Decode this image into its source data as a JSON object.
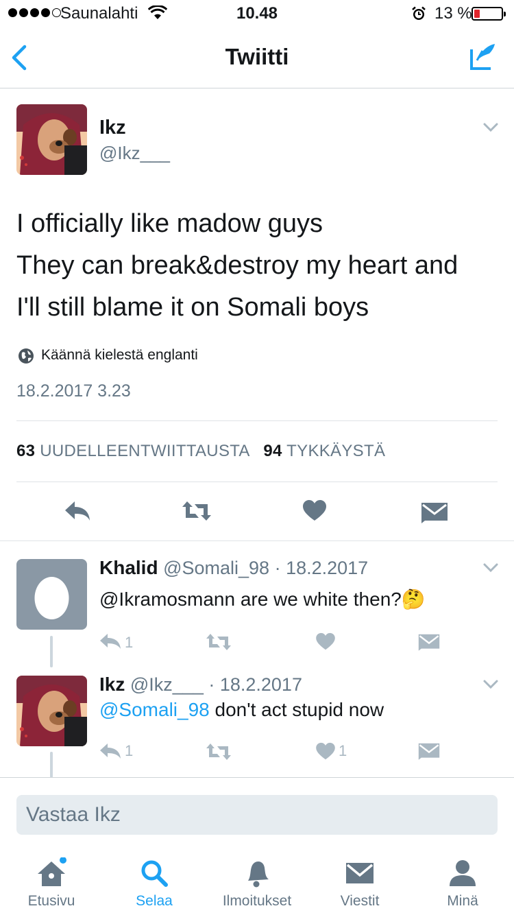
{
  "status_bar": {
    "carrier": "Saunalahti",
    "time": "10.48",
    "battery": "13 %",
    "battery_level": 0.13,
    "signal_bars": 4
  },
  "nav": {
    "title": "Twiitti",
    "back_icon": "chevron-left-icon",
    "compose_icon": "compose-tweet-icon"
  },
  "tweet": {
    "author_name": "Ikz",
    "author_handle": "@Ikz___",
    "text": "I officially like madow guys\nThey can break&destroy my heart and\nI'll still blame it on Somali boys",
    "translate": "Käännä kielestä englanti",
    "date": "18.2.2017 3.23",
    "retweet_count": "63",
    "retweet_label": "UUDELLEENTWIITTAUSTA",
    "like_count": "94",
    "like_label": "TYKKÄYSTÄ"
  },
  "replies": [
    {
      "name": "Khalid",
      "handle": "@Somali_98",
      "date": "· 18.2.2017",
      "text": "@Ikramosmann are we white then?🤔",
      "reply_count": "1",
      "like_count": ""
    },
    {
      "name": "Ikz",
      "handle": "@Ikz___",
      "date": "· 18.2.2017",
      "mention": "@Somali_98",
      "text": " don't act stupid now",
      "reply_count": "1",
      "like_count": "1"
    }
  ],
  "reply_input": {
    "placeholder": "Vastaa Ikz"
  },
  "tabs": [
    {
      "label": "Etusivu",
      "icon": "home-icon"
    },
    {
      "label": "Selaa",
      "icon": "search-icon"
    },
    {
      "label": "Ilmoitukset",
      "icon": "bell-icon"
    },
    {
      "label": "Viestit",
      "icon": "envelope-icon"
    },
    {
      "label": "Minä",
      "icon": "profile-icon"
    }
  ],
  "colors": {
    "accent": "#1da1f2",
    "action_gray": "#657786",
    "muted_gray": "#aab8c2"
  }
}
